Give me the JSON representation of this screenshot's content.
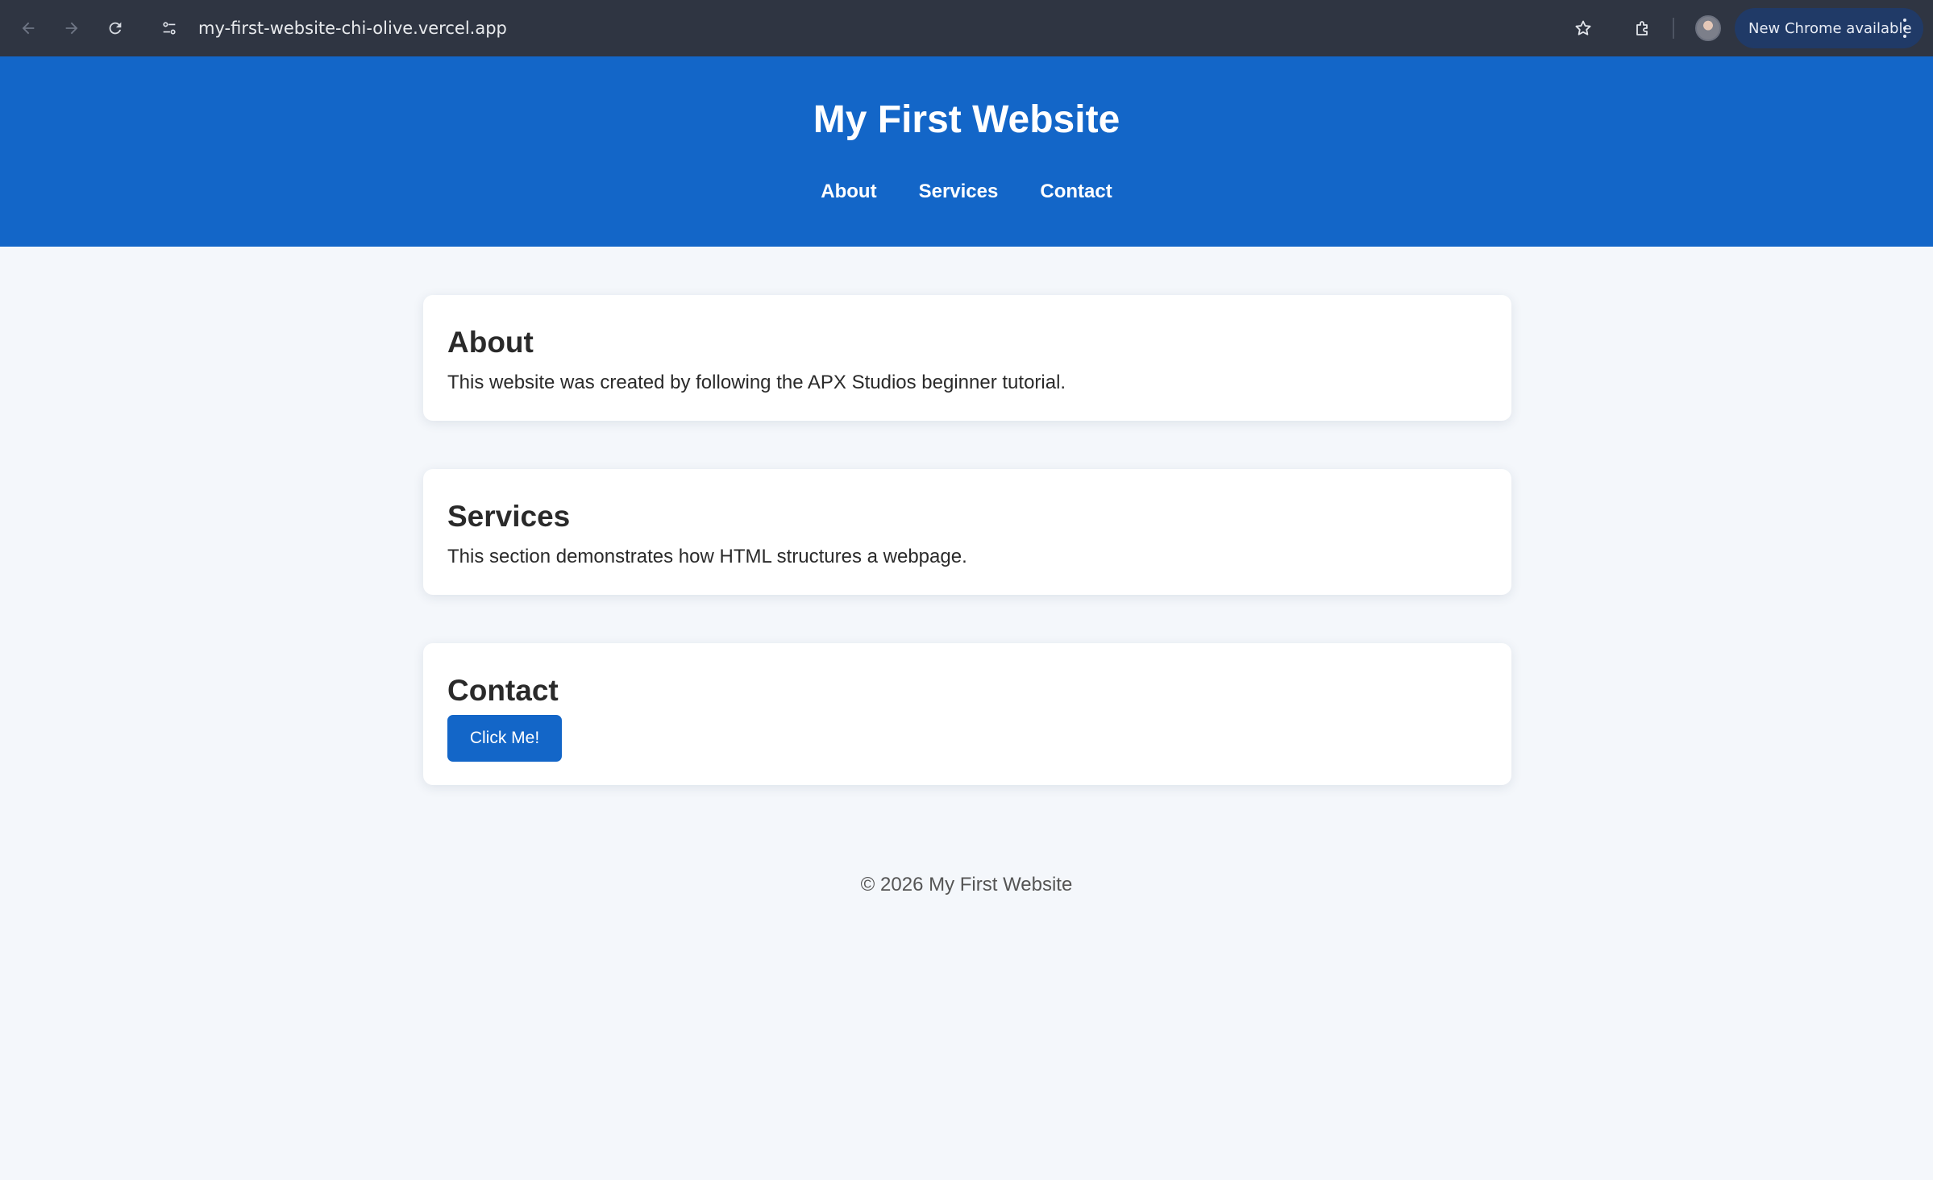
{
  "browser": {
    "url": "my-first-website-chi-olive.vercel.app",
    "update_label": "New Chrome available"
  },
  "site": {
    "title": "My First Website",
    "nav": [
      "About",
      "Services",
      "Contact"
    ]
  },
  "sections": {
    "about": {
      "heading": "About",
      "text": "This website was created by following the APX Studios beginner tutorial."
    },
    "services": {
      "heading": "Services",
      "text": "This section demonstrates how HTML structures a webpage."
    },
    "contact": {
      "heading": "Contact",
      "button_label": "Click Me!"
    }
  },
  "footer": {
    "text": "© 2026 My First Website"
  },
  "colors": {
    "header_bg": "#1366c8",
    "page_bg": "#f4f7fb",
    "browser_bar": "#2f3542",
    "button_bg": "#1366c8"
  }
}
